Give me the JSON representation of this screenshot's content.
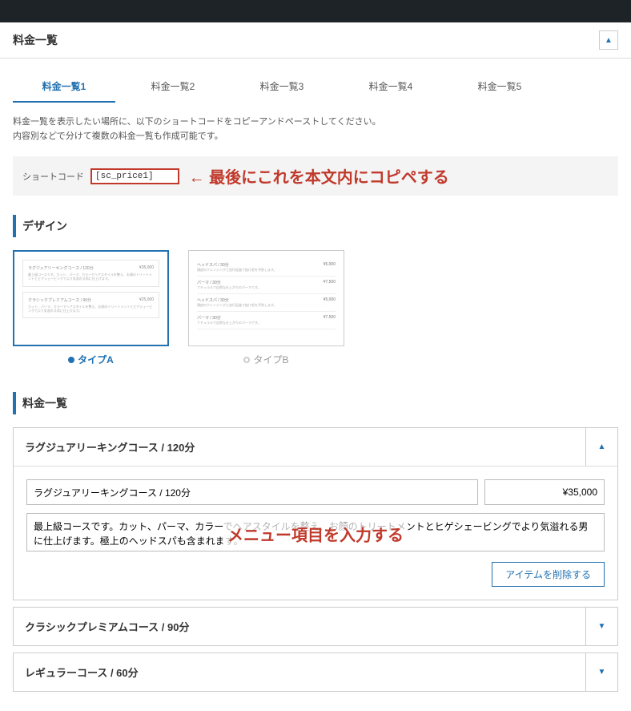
{
  "header": {
    "title": "料金一覧"
  },
  "tabs": [
    "料金一覧1",
    "料金一覧2",
    "料金一覧3",
    "料金一覧4",
    "料金一覧5"
  ],
  "instructions": {
    "line1": "料金一覧を表示したい場所に、以下のショートコードをコピーアンドペーストしてください。",
    "line2": "内容別などで分けて複数の料金一覧も作成可能です。"
  },
  "shortcode": {
    "label": "ショートコード",
    "value": "[sc_price1]"
  },
  "annotation1": "← 最後にこれを本文内にコピペする",
  "design": {
    "heading": "デザイン",
    "typeA": "タイプA",
    "typeB": "タイプB"
  },
  "list": {
    "heading": "料金一覧",
    "item1": {
      "title": "ラグジュアリーキングコース / 120分",
      "name_value": "ラグジュアリーキングコース / 120分",
      "price_value": "¥35,000",
      "desc_value": "最上級コースです。カット、パーマ、カラーでヘアスタイルを整え、お顔のトリートメントとヒゲシェービングでより気溢れる男に仕上げます。極上のヘッドスパも含まれます。"
    },
    "item2": {
      "title": "クラシックプレミアムコース / 90分"
    },
    "item3": {
      "title": "レギュラーコース / 60分"
    },
    "delete_label": "アイテムを削除する"
  },
  "annotation2": "メニュー項目を入力する"
}
